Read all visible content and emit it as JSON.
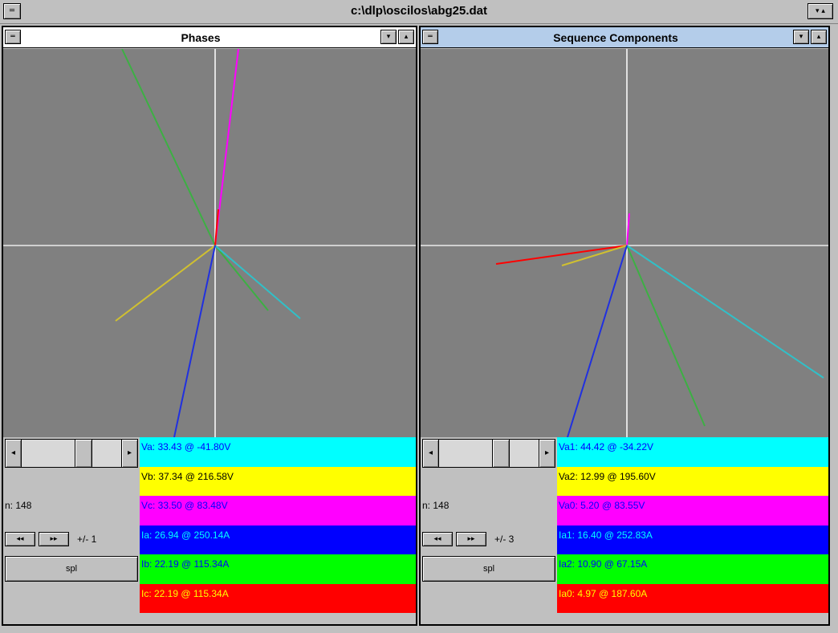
{
  "window": {
    "title": "c:\\dlp\\oscilos\\abg25.dat",
    "sys_menu_glyph": "═",
    "scroll_glyph": "▾ ▴"
  },
  "colors": {
    "cyan": "#00ffff",
    "yellow": "#ffff00",
    "magenta": "#ff00ff",
    "blue": "#0000ff",
    "green": "#00ff00",
    "red": "#ff0000",
    "plot_bg": "#808080",
    "axis": "#d8d8d8"
  },
  "panes": {
    "left": {
      "title": "Phases",
      "sys_menu_glyph": "═",
      "down_glyph": "▾",
      "up_glyph": "▴",
      "scroll_left": "◂",
      "scroll_right": "▸",
      "n_label": "n: 148",
      "step_back_label": "◂◂",
      "step_fwd_label": "▸▸",
      "step_label": "+/- 1",
      "action_button": "spl",
      "readouts": [
        {
          "text": "Va: 33.43 @ -41.80V",
          "bg": "#00ffff",
          "fg": "#0000ff"
        },
        {
          "text": "Vb: 37.34 @ 216.58V",
          "bg": "#ffff00",
          "fg": "#000000"
        },
        {
          "text": "Vc: 33.50 @ 83.48V",
          "bg": "#ff00ff",
          "fg": "#0000ff"
        },
        {
          "text": "Ia: 26.94 @ 250.14A",
          "bg": "#0000ff",
          "fg": "#00ffff"
        },
        {
          "text": "Ib: 22.19 @ 115.34A",
          "bg": "#00ff00",
          "fg": "#0000ff"
        },
        {
          "text": "Ic: 22.19 @ 115.34A",
          "bg": "#ff0000",
          "fg": "#ffff00"
        }
      ]
    },
    "right": {
      "title": "Sequence Components",
      "sys_menu_glyph": "═",
      "down_glyph": "▾",
      "up_glyph": "▴",
      "scroll_left": "◂",
      "scroll_right": "▸",
      "n_label": "n: 148",
      "step_back_label": "◂◂",
      "step_fwd_label": "▸▸",
      "step_label": "+/- 3",
      "action_button": "spl",
      "readouts": [
        {
          "text": "Va1: 44.42 @ -34.22V",
          "bg": "#00ffff",
          "fg": "#0000ff"
        },
        {
          "text": "Va2: 12.99 @ 195.60V",
          "bg": "#ffff00",
          "fg": "#000000"
        },
        {
          "text": "Va0: 5.20 @ 83.55V",
          "bg": "#ff00ff",
          "fg": "#0000ff"
        },
        {
          "text": "Ia1: 16.40 @ 252.83A",
          "bg": "#0000ff",
          "fg": "#00ffff"
        },
        {
          "text": "Ia2: 10.90 @ 67.15A",
          "bg": "#00ff00",
          "fg": "#0000ff"
        },
        {
          "text": "Ia0: 4.97 @ 187.60A",
          "bg": "#ff0000",
          "fg": "#ffff00"
        }
      ]
    }
  }
}
